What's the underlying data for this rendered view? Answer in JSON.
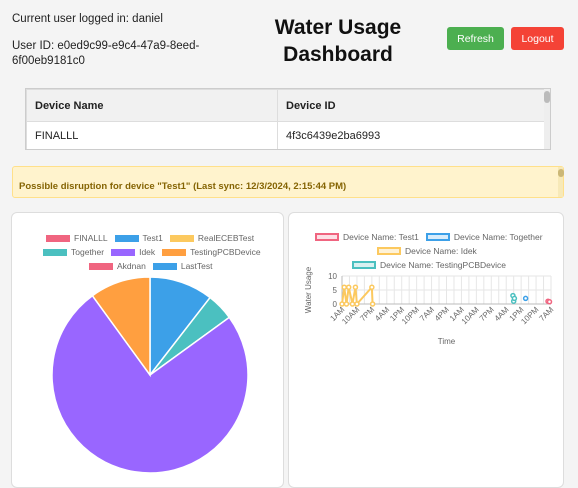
{
  "user": {
    "logged_in_label": "Current user logged in: daniel",
    "id_label": "User ID: e0ed9c99-e9c4-47a9-8eed-6f00eb9181c0"
  },
  "header": {
    "title": "Water Usage Dashboard"
  },
  "buttons": {
    "refresh": "Refresh",
    "logout": "Logout"
  },
  "device_table": {
    "headers": [
      "Device Name",
      "Device ID"
    ],
    "rows": [
      {
        "name": "FINALLL",
        "id": "4f3c6439e2ba6993"
      }
    ]
  },
  "alert": {
    "text": "Possible disruption for device \"Test1\" (Last sync: 12/3/2024, 2:15:44 PM)"
  },
  "colors": {
    "red": "#f06580",
    "blue": "#3ca0e8",
    "yellow": "#fcc95f",
    "teal": "#4bc0c0",
    "purple": "#9966ff",
    "orange": "#ff9f40",
    "grey": "#c9cbcf",
    "refresh": "#4caf50",
    "logout": "#f44336",
    "alert_bg": "#fff3cd"
  },
  "chart_data": [
    {
      "type": "pie",
      "legend": [
        "FINALLL",
        "Test1",
        "RealECEBTest",
        "Together",
        "Idek",
        "TestingPCBDevice",
        "Akdnan",
        "LastTest"
      ],
      "legend_colors": [
        "#f06580",
        "#3ca0e8",
        "#fcc95f",
        "#4bc0c0",
        "#9966ff",
        "#ff9f40",
        "#f06580",
        "#3ca0e8"
      ],
      "slices": [
        {
          "label": "Test1",
          "value": 10.5,
          "color": "#3ca0e8"
        },
        {
          "label": "Together",
          "value": 4.5,
          "color": "#4bc0c0"
        },
        {
          "label": "Idek",
          "value": 75,
          "color": "#9966ff"
        },
        {
          "label": "TestingPCBDevice",
          "value": 10,
          "color": "#ff9f40"
        }
      ]
    },
    {
      "type": "line",
      "legend": [
        "Device Name: Test1",
        "Device Name: Together",
        "Device Name: Idek",
        "Device Name: TestingPCBDevice"
      ],
      "legend_colors": [
        "#f06580",
        "#3ca0e8",
        "#fcc95f",
        "#4bc0c0"
      ],
      "ylabel": "Water Usage",
      "xlabel": "Time",
      "ylim": [
        0,
        10
      ],
      "yticks": [
        0,
        5,
        10
      ],
      "xticks": [
        "1AM",
        "10AM",
        "7PM",
        "4AM",
        "1PM",
        "10PM",
        "7AM",
        "4PM",
        "1AM",
        "10AM",
        "7PM",
        "4AM",
        "1PM",
        "10PM",
        "7AM"
      ],
      "series": [
        {
          "name": "Device Name: Idek",
          "color": "#fcc95f",
          "points": [
            [
              0,
              0
            ],
            [
              0.15,
              6
            ],
            [
              0.3,
              0
            ],
            [
              0.45,
              6
            ],
            [
              0.7,
              0
            ],
            [
              0.9,
              6
            ],
            [
              1.0,
              0
            ],
            [
              2.0,
              6
            ],
            [
              2.05,
              0
            ]
          ]
        },
        {
          "name": "Device Name: TestingPCBDevice",
          "color": "#4bc0c0",
          "points": [
            [
              11.45,
              3
            ],
            [
              11.5,
              1
            ],
            [
              11.55,
              2
            ]
          ]
        },
        {
          "name": "Device Name: Together",
          "color": "#3ca0e8",
          "points": [
            [
              12.3,
              2
            ]
          ]
        },
        {
          "name": "Device Name: Test1",
          "color": "#f06580",
          "points": [
            [
              13.8,
              1
            ],
            [
              13.9,
              0.8
            ]
          ]
        }
      ]
    }
  ]
}
